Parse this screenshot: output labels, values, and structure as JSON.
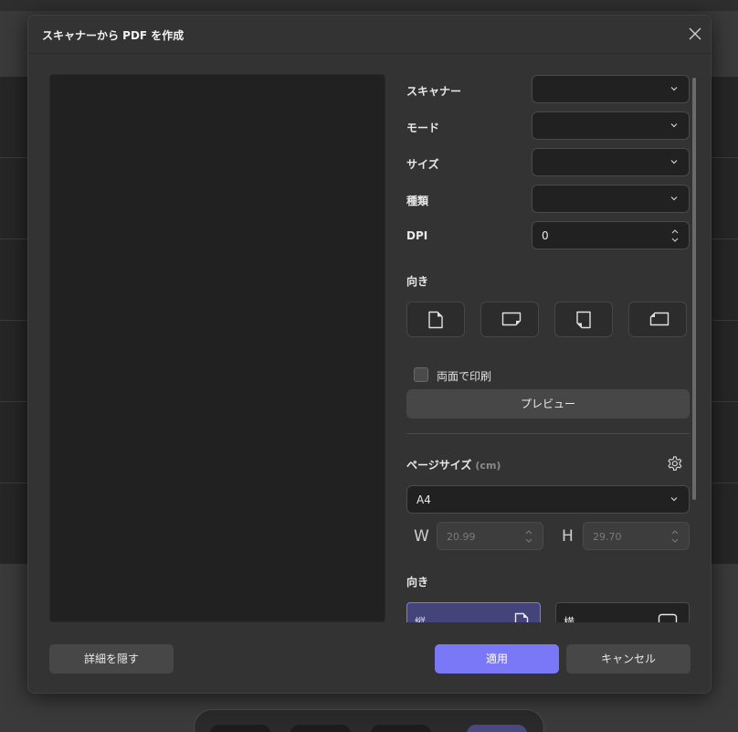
{
  "dialog": {
    "title": "スキャナーから PDF を作成"
  },
  "scanner_settings": {
    "scanner_label": "スキャナー",
    "scanner_value": "",
    "mode_label": "モード",
    "mode_value": "",
    "size_label": "サイズ",
    "size_value": "",
    "type_label": "種類",
    "type_value": "",
    "dpi_label": "DPI",
    "dpi_value": "0",
    "orientation_label": "向き",
    "orientation_icons": [
      "portrait-icon",
      "landscape-icon",
      "portrait-flipped-icon",
      "landscape-flipped-icon"
    ],
    "duplex_label": "両面で印刷",
    "duplex_checked": false,
    "preview_button": "プレビュー"
  },
  "page_size": {
    "label": "ページサイズ",
    "unit": "(cm)",
    "preset": "A4",
    "w_label": "W",
    "w_value": "20.99",
    "h_label": "H",
    "h_value": "29.70",
    "orientation_label": "向き",
    "portrait_label": "縦",
    "landscape_label": "横"
  },
  "footer": {
    "hide_details": "詳細を隠す",
    "apply": "適用",
    "cancel": "キャンセル"
  },
  "colors": {
    "accent": "#7b78f7",
    "dialog_bg": "#333333",
    "field_bg": "#212121"
  }
}
